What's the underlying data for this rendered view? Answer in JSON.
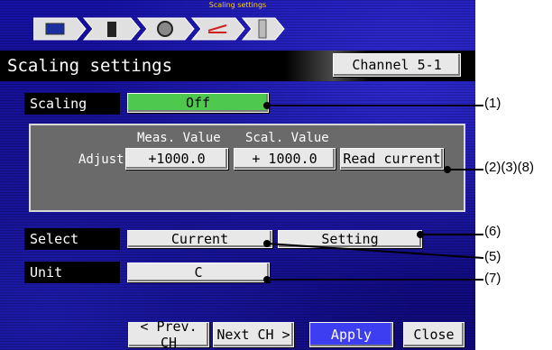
{
  "breadcrumb": {
    "text": "Scaling settings"
  },
  "nav_icons": [
    "monitor-icon",
    "bar-icon",
    "gear-icon",
    "wave-icon",
    "ruler-icon"
  ],
  "header": {
    "title": "Scaling settings",
    "channel_button": "Channel 5-1"
  },
  "scaling": {
    "label": "Scaling",
    "value": "Off",
    "value_color": "#4ec94e"
  },
  "adjust": {
    "label": "Adjust",
    "meas_header": "Meas. Value",
    "scal_header": "Scal. Value",
    "meas_value": "+1000.0",
    "scal_value": "+ 1000.0",
    "read_current": "Read current"
  },
  "select": {
    "label": "Select",
    "option_current": "Current",
    "option_setting": "Setting"
  },
  "unit": {
    "label": "Unit",
    "value": "C"
  },
  "footer": {
    "prev": "< Prev. CH",
    "next": "Next CH >",
    "apply": "Apply",
    "close": "Close",
    "apply_color": "#3d3df2"
  },
  "callouts": {
    "c1": "(1)",
    "c2": "(2)(3)(8)",
    "c6": "(6)",
    "c5": "(5)",
    "c7": "(7)"
  }
}
